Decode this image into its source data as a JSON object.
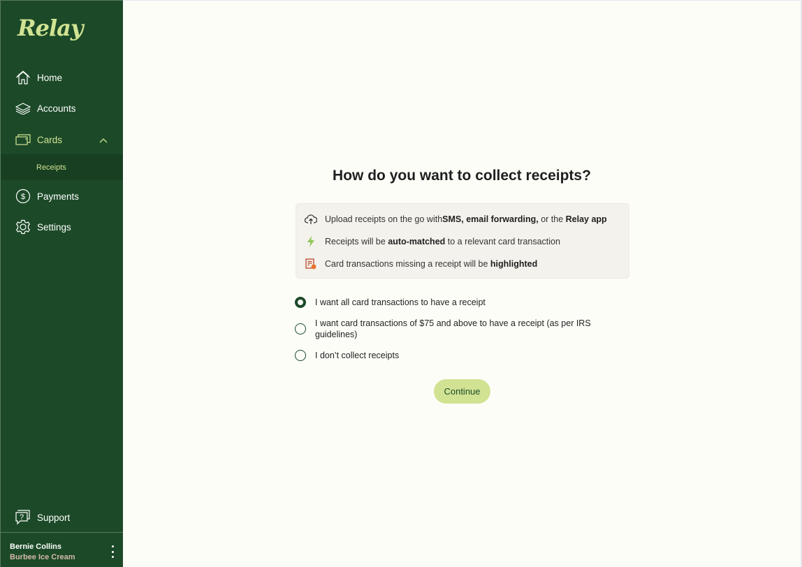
{
  "app": {
    "logo": "Relay"
  },
  "sidebar": {
    "items": [
      {
        "label": "Home",
        "icon": "home-icon"
      },
      {
        "label": "Accounts",
        "icon": "layers-icon"
      },
      {
        "label": "Cards",
        "icon": "card-icon",
        "expanded": true,
        "active": true
      },
      {
        "label": "Payments",
        "icon": "dollar-circle-icon"
      },
      {
        "label": "Settings",
        "icon": "gear-icon"
      }
    ],
    "sub_items": [
      {
        "label": "Receipts",
        "active": true
      }
    ],
    "support": {
      "label": "Support",
      "icon": "help-chat-icon"
    },
    "user": {
      "name": "Bernie Collins",
      "org": "Burbee Ice Cream"
    }
  },
  "main": {
    "title": "How do you want to collect receipts?",
    "info": [
      {
        "icon": "cloud-upload-icon",
        "parts": [
          "Upload receipts on the go with ",
          "SMS, email forwarding,",
          " or the ",
          "Relay app",
          ""
        ]
      },
      {
        "icon": "lightning-icon",
        "parts": [
          "Receipts will be ",
          "auto-matched",
          " to a relevant card transaction"
        ]
      },
      {
        "icon": "receipt-alert-icon",
        "parts": [
          "Card transactions missing a receipt will be ",
          "highlighted",
          ""
        ]
      }
    ],
    "options": [
      {
        "label": "I want all card transactions to have a receipt",
        "selected": true
      },
      {
        "label": "I want card transactions of $75 and above to have a receipt (as per IRS guidelines)",
        "selected": false
      },
      {
        "label": "I don’t collect receipts",
        "selected": false
      }
    ],
    "continue_label": "Continue"
  },
  "colors": {
    "sidebar": "#1c4a28",
    "accent": "#d1e393",
    "background": "#fdfdf8"
  }
}
